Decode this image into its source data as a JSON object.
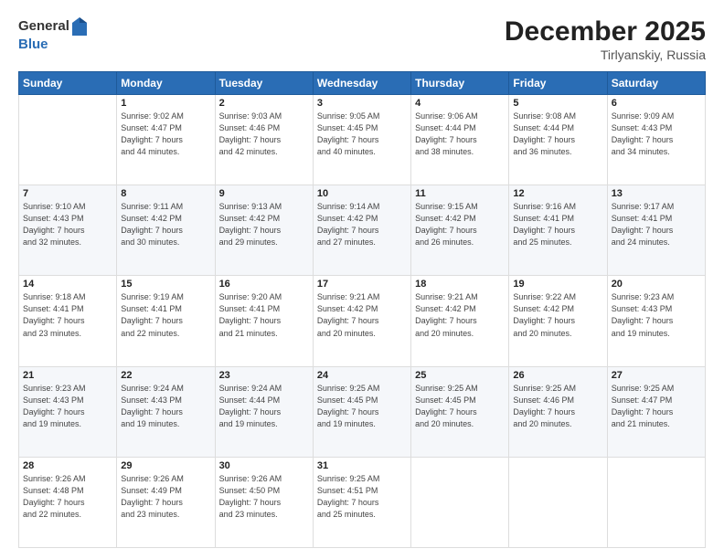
{
  "header": {
    "logo_general": "General",
    "logo_blue": "Blue",
    "title": "December 2025",
    "location": "Tirlyanskiy, Russia"
  },
  "weekdays": [
    "Sunday",
    "Monday",
    "Tuesday",
    "Wednesday",
    "Thursday",
    "Friday",
    "Saturday"
  ],
  "weeks": [
    [
      {
        "day": "",
        "text": ""
      },
      {
        "day": "1",
        "text": "Sunrise: 9:02 AM\nSunset: 4:47 PM\nDaylight: 7 hours\nand 44 minutes."
      },
      {
        "day": "2",
        "text": "Sunrise: 9:03 AM\nSunset: 4:46 PM\nDaylight: 7 hours\nand 42 minutes."
      },
      {
        "day": "3",
        "text": "Sunrise: 9:05 AM\nSunset: 4:45 PM\nDaylight: 7 hours\nand 40 minutes."
      },
      {
        "day": "4",
        "text": "Sunrise: 9:06 AM\nSunset: 4:44 PM\nDaylight: 7 hours\nand 38 minutes."
      },
      {
        "day": "5",
        "text": "Sunrise: 9:08 AM\nSunset: 4:44 PM\nDaylight: 7 hours\nand 36 minutes."
      },
      {
        "day": "6",
        "text": "Sunrise: 9:09 AM\nSunset: 4:43 PM\nDaylight: 7 hours\nand 34 minutes."
      }
    ],
    [
      {
        "day": "7",
        "text": "Sunrise: 9:10 AM\nSunset: 4:43 PM\nDaylight: 7 hours\nand 32 minutes."
      },
      {
        "day": "8",
        "text": "Sunrise: 9:11 AM\nSunset: 4:42 PM\nDaylight: 7 hours\nand 30 minutes."
      },
      {
        "day": "9",
        "text": "Sunrise: 9:13 AM\nSunset: 4:42 PM\nDaylight: 7 hours\nand 29 minutes."
      },
      {
        "day": "10",
        "text": "Sunrise: 9:14 AM\nSunset: 4:42 PM\nDaylight: 7 hours\nand 27 minutes."
      },
      {
        "day": "11",
        "text": "Sunrise: 9:15 AM\nSunset: 4:42 PM\nDaylight: 7 hours\nand 26 minutes."
      },
      {
        "day": "12",
        "text": "Sunrise: 9:16 AM\nSunset: 4:41 PM\nDaylight: 7 hours\nand 25 minutes."
      },
      {
        "day": "13",
        "text": "Sunrise: 9:17 AM\nSunset: 4:41 PM\nDaylight: 7 hours\nand 24 minutes."
      }
    ],
    [
      {
        "day": "14",
        "text": "Sunrise: 9:18 AM\nSunset: 4:41 PM\nDaylight: 7 hours\nand 23 minutes."
      },
      {
        "day": "15",
        "text": "Sunrise: 9:19 AM\nSunset: 4:41 PM\nDaylight: 7 hours\nand 22 minutes."
      },
      {
        "day": "16",
        "text": "Sunrise: 9:20 AM\nSunset: 4:41 PM\nDaylight: 7 hours\nand 21 minutes."
      },
      {
        "day": "17",
        "text": "Sunrise: 9:21 AM\nSunset: 4:42 PM\nDaylight: 7 hours\nand 20 minutes."
      },
      {
        "day": "18",
        "text": "Sunrise: 9:21 AM\nSunset: 4:42 PM\nDaylight: 7 hours\nand 20 minutes."
      },
      {
        "day": "19",
        "text": "Sunrise: 9:22 AM\nSunset: 4:42 PM\nDaylight: 7 hours\nand 20 minutes."
      },
      {
        "day": "20",
        "text": "Sunrise: 9:23 AM\nSunset: 4:43 PM\nDaylight: 7 hours\nand 19 minutes."
      }
    ],
    [
      {
        "day": "21",
        "text": "Sunrise: 9:23 AM\nSunset: 4:43 PM\nDaylight: 7 hours\nand 19 minutes."
      },
      {
        "day": "22",
        "text": "Sunrise: 9:24 AM\nSunset: 4:43 PM\nDaylight: 7 hours\nand 19 minutes."
      },
      {
        "day": "23",
        "text": "Sunrise: 9:24 AM\nSunset: 4:44 PM\nDaylight: 7 hours\nand 19 minutes."
      },
      {
        "day": "24",
        "text": "Sunrise: 9:25 AM\nSunset: 4:45 PM\nDaylight: 7 hours\nand 19 minutes."
      },
      {
        "day": "25",
        "text": "Sunrise: 9:25 AM\nSunset: 4:45 PM\nDaylight: 7 hours\nand 20 minutes."
      },
      {
        "day": "26",
        "text": "Sunrise: 9:25 AM\nSunset: 4:46 PM\nDaylight: 7 hours\nand 20 minutes."
      },
      {
        "day": "27",
        "text": "Sunrise: 9:25 AM\nSunset: 4:47 PM\nDaylight: 7 hours\nand 21 minutes."
      }
    ],
    [
      {
        "day": "28",
        "text": "Sunrise: 9:26 AM\nSunset: 4:48 PM\nDaylight: 7 hours\nand 22 minutes."
      },
      {
        "day": "29",
        "text": "Sunrise: 9:26 AM\nSunset: 4:49 PM\nDaylight: 7 hours\nand 23 minutes."
      },
      {
        "day": "30",
        "text": "Sunrise: 9:26 AM\nSunset: 4:50 PM\nDaylight: 7 hours\nand 23 minutes."
      },
      {
        "day": "31",
        "text": "Sunrise: 9:25 AM\nSunset: 4:51 PM\nDaylight: 7 hours\nand 25 minutes."
      },
      {
        "day": "",
        "text": ""
      },
      {
        "day": "",
        "text": ""
      },
      {
        "day": "",
        "text": ""
      }
    ]
  ]
}
